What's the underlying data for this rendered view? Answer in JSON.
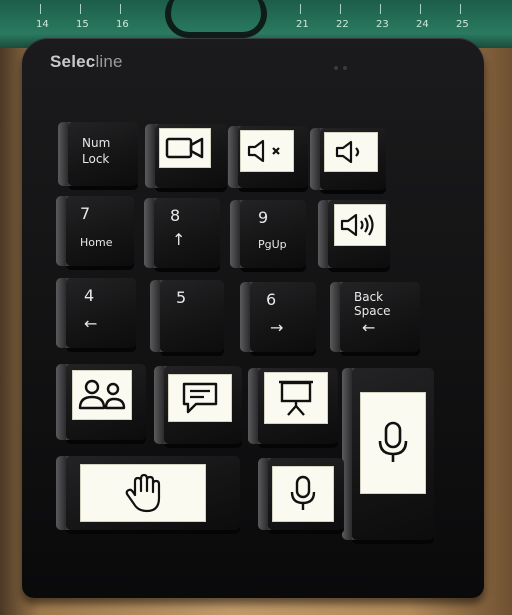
{
  "brand": {
    "name_bold": "Selec",
    "name_light": "line"
  },
  "ruler": {
    "marks": [
      "14",
      "15",
      "16",
      "21",
      "22",
      "23",
      "24",
      "25"
    ]
  },
  "keys": {
    "numlock": {
      "line1": "Num",
      "line2": "Lock"
    },
    "k7": {
      "num": "7",
      "sub": "Home"
    },
    "k8": {
      "num": "8",
      "sub": "↑"
    },
    "k9": {
      "num": "9",
      "sub": "PgUp"
    },
    "k4": {
      "num": "4",
      "sub": "←"
    },
    "k5": {
      "num": "5"
    },
    "k6": {
      "num": "6",
      "sub": "→"
    },
    "backspace": {
      "line1": "Back",
      "line2": "Space",
      "sub": "←"
    }
  },
  "stickers": {
    "video": "video-camera-icon",
    "mute": "speaker-mute-icon",
    "volume_down": "speaker-low-icon",
    "volume_up": "speaker-loud-icon",
    "participants": "people-icon",
    "chat": "chat-bubble-icon",
    "share_screen": "presentation-screen-icon",
    "raise_hand": "hand-icon",
    "mic_tall": "microphone-icon",
    "mic_small": "microphone-icon"
  },
  "colors": {
    "sticker": "#fbfaf0",
    "key": "#151516",
    "legend": "#e8e8e8",
    "mat": "#2a7a60"
  }
}
